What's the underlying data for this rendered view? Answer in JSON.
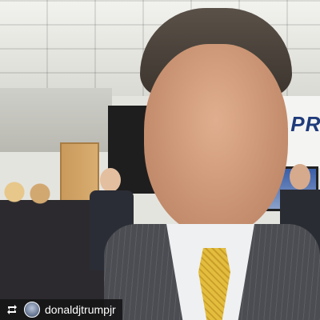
{
  "background_sign": {
    "text": ".PR"
  },
  "overlay": {
    "repost_icon": "repost-icon",
    "username": "donaldjtrumpjr"
  },
  "colors": {
    "sign_text": "#1f3b7a",
    "tie": "#e3bd3e",
    "suit": "#4b4d52",
    "overlay_bg": "#141416"
  }
}
